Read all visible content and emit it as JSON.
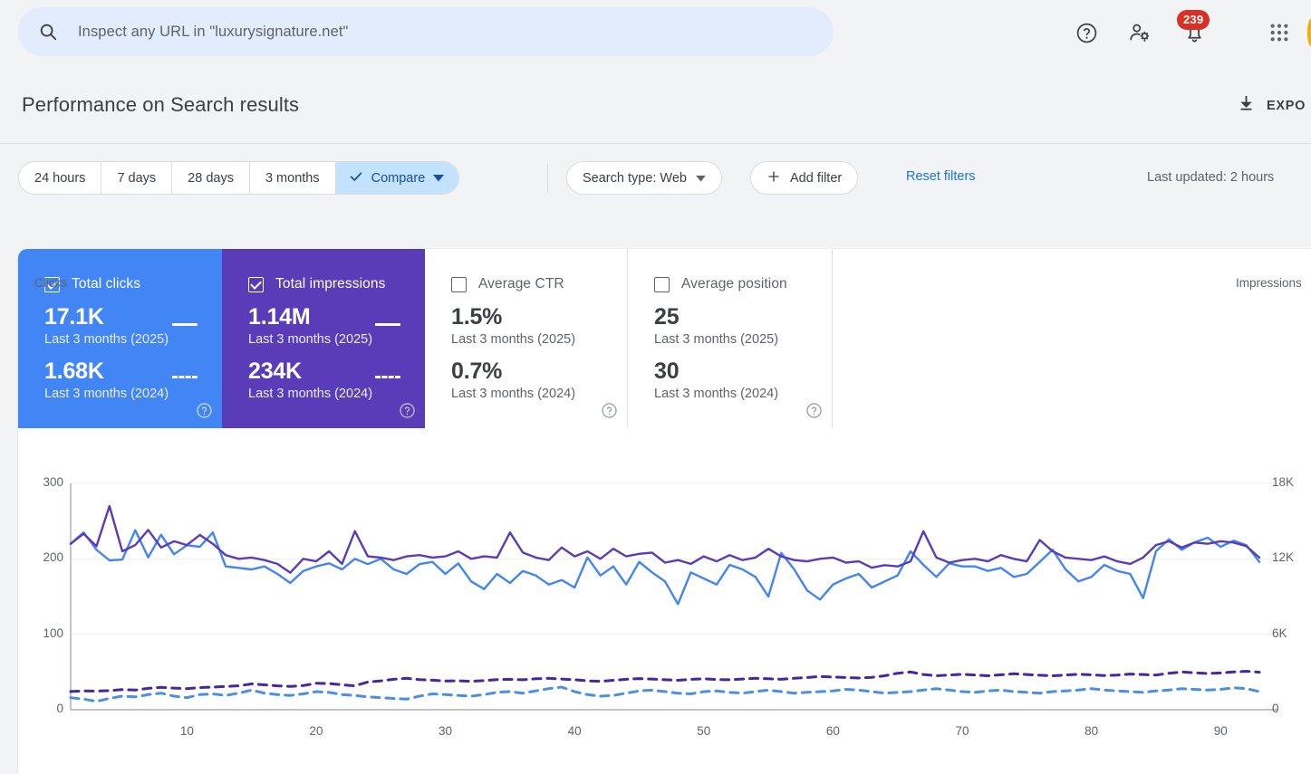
{
  "topbar": {
    "search_placeholder": "Inspect any URL in \"luxurysignature.net\"",
    "search_icon": "search-icon",
    "help_icon": "help-circle-icon",
    "users_icon": "user-settings-icon",
    "bell_icon": "notifications-bell-icon",
    "bell_badge": "239",
    "apps_icon": "apps-grid-icon"
  },
  "header": {
    "title": "Performance on Search results",
    "export_label": "EXPO",
    "export_icon": "download-icon"
  },
  "toolbar": {
    "date_buttons": [
      {
        "label": "24 hours",
        "active": false
      },
      {
        "label": "7 days",
        "active": false
      },
      {
        "label": "28 days",
        "active": false
      },
      {
        "label": "3 months",
        "active": false
      }
    ],
    "compare_label": "Compare",
    "compare_check_icon": "check-icon",
    "compare_caret_icon": "chevron-down-icon",
    "search_type_label": "Search type: Web",
    "search_type_caret_icon": "chevron-down-icon",
    "add_filter_label": "Add filter",
    "add_filter_icon": "plus-icon",
    "reset_filters_label": "Reset filters",
    "last_updated": "Last updated: 2 hours"
  },
  "cards": [
    {
      "name": "total-clicks",
      "label": "Total clicks",
      "checked": true,
      "selected": true,
      "color": "#4285f4",
      "current_value": "17.1K",
      "current_period": "Last 3 months (2025)",
      "compare_value": "1.68K",
      "compare_period": "Last 3 months (2024)",
      "help_icon": "help-circle-icon"
    },
    {
      "name": "total-impressions",
      "label": "Total impressions",
      "checked": true,
      "selected": true,
      "color": "#5b3cb8",
      "current_value": "1.14M",
      "current_period": "Last 3 months (2025)",
      "compare_value": "234K",
      "compare_period": "Last 3 months (2024)",
      "help_icon": "help-circle-icon"
    },
    {
      "name": "average-ctr",
      "label": "Average CTR",
      "checked": false,
      "selected": false,
      "color": "#ffffff",
      "current_value": "1.5%",
      "current_period": "Last 3 months (2025)",
      "compare_value": "0.7%",
      "compare_period": "Last 3 months (2024)",
      "help_icon": "help-circle-icon"
    },
    {
      "name": "average-position",
      "label": "Average position",
      "checked": false,
      "selected": false,
      "color": "#ffffff",
      "current_value": "25",
      "current_period": "Last 3 months (2025)",
      "compare_value": "30",
      "compare_period": "Last 3 months (2024)",
      "help_icon": "help-circle-icon"
    }
  ],
  "chart_data": {
    "type": "line",
    "title": "",
    "xlabel": "",
    "ylabel": "Clicks",
    "y2label": "Impressions",
    "ylim": [
      0,
      300
    ],
    "y2lim": [
      0,
      18000
    ],
    "yticks": [
      "300",
      "200",
      "100",
      "0"
    ],
    "y2ticks": [
      "18K",
      "12K",
      "6K",
      "0"
    ],
    "xticks": [
      "10",
      "20",
      "30",
      "40",
      "50",
      "60",
      "70",
      "80",
      "90"
    ],
    "xlim": [
      1,
      93
    ],
    "grid": true,
    "legend_position": "cards-above",
    "series": [
      {
        "name": "Clicks — Last 3 months (2025)",
        "axis": "left",
        "color": "#4285f4",
        "style": "solid",
        "values": [
          220,
          235,
          212,
          198,
          199,
          238,
          202,
          232,
          206,
          218,
          216,
          235,
          190,
          188,
          186,
          190,
          180,
          168,
          184,
          190,
          194,
          186,
          200,
          193,
          200,
          186,
          180,
          193,
          196,
          180,
          194,
          170,
          160,
          180,
          168,
          184,
          178,
          166,
          172,
          162,
          202,
          178,
          190,
          166,
          196,
          182,
          170,
          140,
          182,
          174,
          166,
          192,
          186,
          176,
          150,
          208,
          186,
          158,
          146,
          166,
          174,
          180,
          162,
          170,
          178,
          210,
          192,
          176,
          194,
          190,
          190,
          184,
          188,
          176,
          180,
          196,
          212,
          186,
          170,
          176,
          192,
          184,
          180,
          148,
          210,
          226,
          212,
          222,
          228,
          216,
          224,
          218,
          196
        ]
      },
      {
        "name": "Impressions — Last 3 months (2025)",
        "axis": "right",
        "color": "#5b3cb8",
        "style": "solid",
        "values": [
          13200,
          14000,
          13000,
          16200,
          12600,
          13100,
          14300,
          12900,
          13400,
          13100,
          13900,
          13200,
          12300,
          12000,
          12100,
          11900,
          11600,
          10900,
          12000,
          11800,
          12600,
          11600,
          14200,
          12200,
          12100,
          11900,
          12200,
          12300,
          12100,
          12200,
          12600,
          12000,
          12200,
          12100,
          14100,
          12500,
          12100,
          11900,
          12900,
          12200,
          12600,
          12000,
          12800,
          12200,
          12400,
          12500,
          11700,
          11900,
          11600,
          12200,
          11800,
          12300,
          11900,
          12100,
          12800,
          12200,
          11900,
          11800,
          12000,
          12100,
          11700,
          11800,
          11300,
          11500,
          11400,
          11800,
          14200,
          12100,
          11700,
          11900,
          12000,
          11800,
          12300,
          12000,
          11800,
          13500,
          12600,
          12100,
          12000,
          11900,
          12200,
          11800,
          11600,
          12100,
          13100,
          13400,
          12900,
          13300,
          13200,
          13400,
          13300,
          13000,
          12100
        ]
      },
      {
        "name": "Clicks — Last 3 months (2024)",
        "axis": "left",
        "color": "#4a90e2",
        "style": "dashed",
        "values": [
          16,
          14,
          11,
          15,
          18,
          17,
          20,
          22,
          18,
          16,
          20,
          21,
          19,
          22,
          26,
          22,
          20,
          19,
          21,
          24,
          23,
          20,
          19,
          17,
          16,
          15,
          14,
          18,
          21,
          20,
          19,
          18,
          20,
          23,
          24,
          22,
          25,
          28,
          30,
          24,
          20,
          18,
          19,
          22,
          25,
          26,
          24,
          22,
          21,
          24,
          25,
          23,
          22,
          24,
          26,
          24,
          22,
          23,
          24,
          25,
          27,
          26,
          24,
          22,
          23,
          24,
          26,
          28,
          26,
          24,
          23,
          25,
          26,
          24,
          23,
          22,
          24,
          25,
          26,
          28,
          26,
          25,
          24,
          23,
          25,
          26,
          28,
          27,
          26,
          27,
          29,
          28,
          24
        ]
      },
      {
        "name": "Impressions — Last 3 months (2024)",
        "axis": "right",
        "color": "#4527a0",
        "style": "dashed",
        "values": [
          1450,
          1500,
          1480,
          1520,
          1600,
          1560,
          1700,
          1780,
          1720,
          1680,
          1760,
          1800,
          1850,
          1900,
          2050,
          1980,
          1900,
          1860,
          1920,
          2100,
          2080,
          1980,
          1900,
          2200,
          2300,
          2420,
          2500,
          2400,
          2350,
          2280,
          2300,
          2260,
          2320,
          2400,
          2420,
          2380,
          2460,
          2500,
          2440,
          2380,
          2300,
          2260,
          2340,
          2420,
          2480,
          2440,
          2380,
          2340,
          2420,
          2460,
          2400,
          2380,
          2440,
          2500,
          2460,
          2420,
          2500,
          2560,
          2640,
          2600,
          2560,
          2520,
          2580,
          2700,
          2900,
          3000,
          2800,
          2700,
          2760,
          2820,
          2760,
          2700,
          2780,
          2860,
          2800,
          2740,
          2700,
          2760,
          2820,
          2780,
          2720,
          2760,
          2840,
          2800,
          2760,
          2900,
          3000,
          2940,
          2880,
          2920,
          3000,
          3060,
          2980
        ]
      }
    ]
  }
}
